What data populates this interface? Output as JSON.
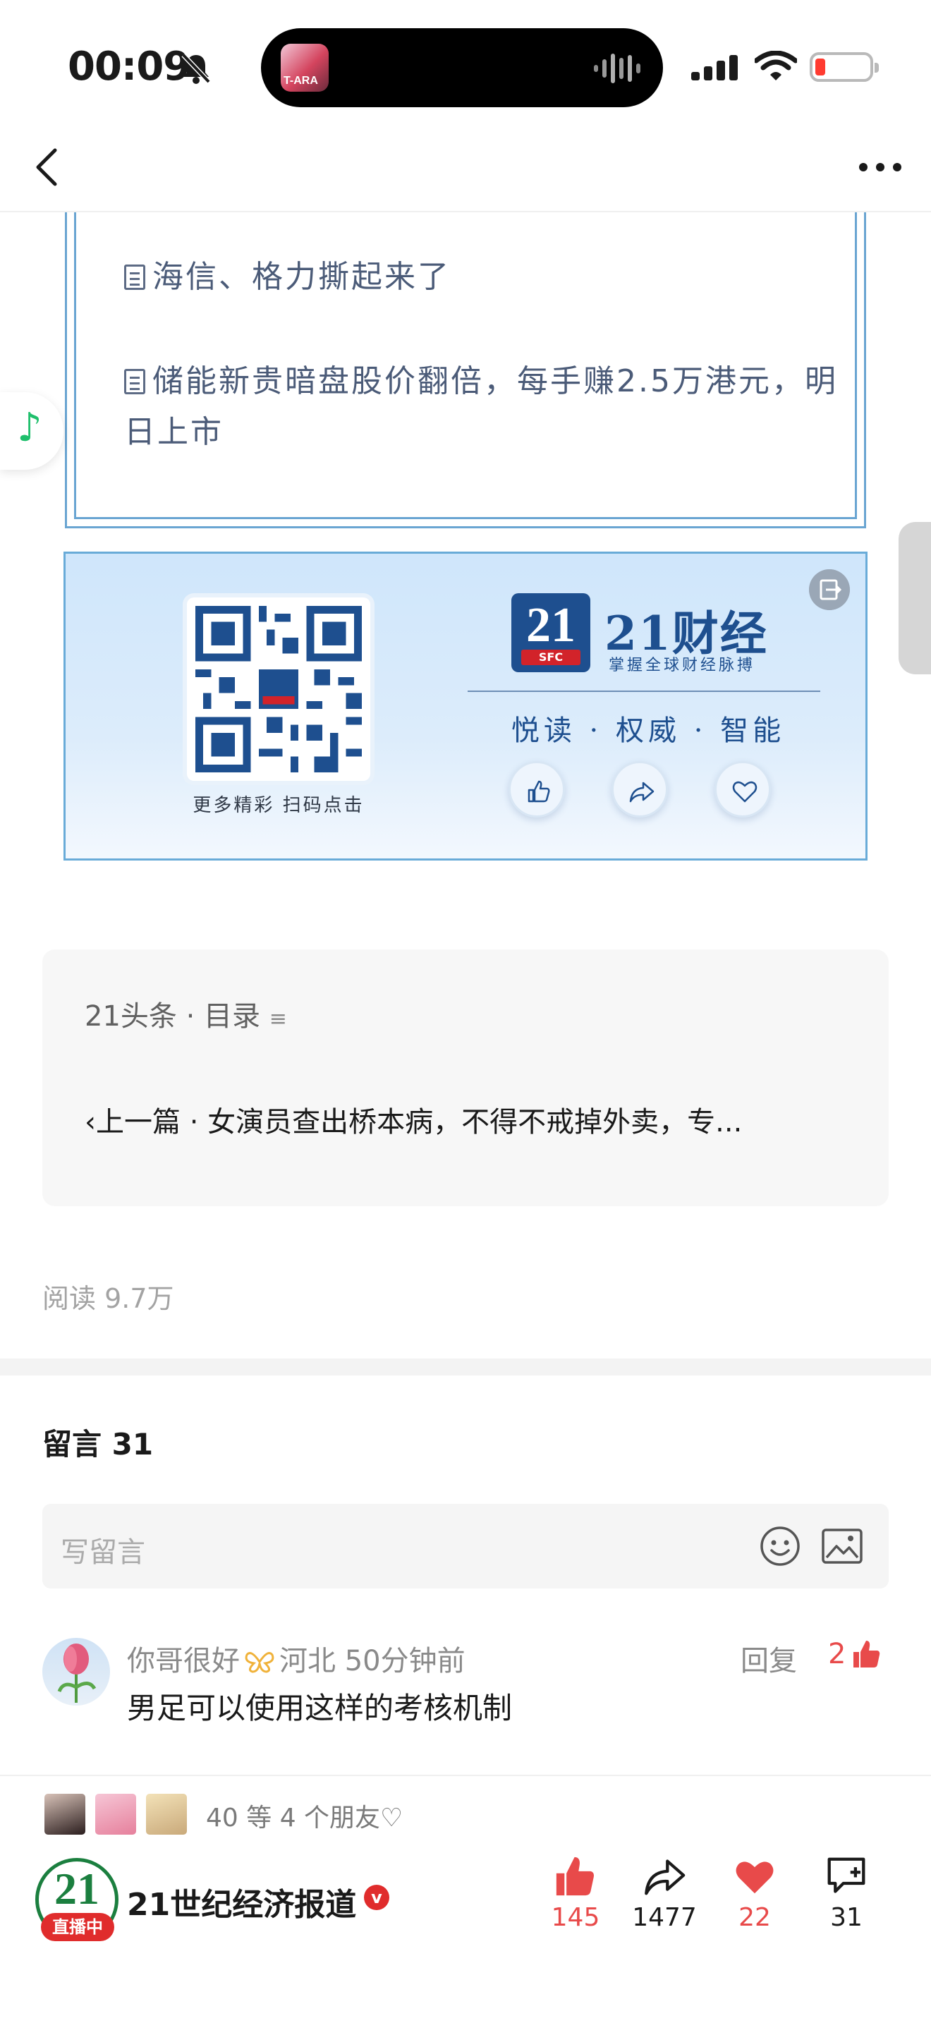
{
  "status_bar": {
    "time": "00:09",
    "island_thumb_text": "T-ARA"
  },
  "related_articles": [
    {
      "title": "海信、格力撕起来了"
    },
    {
      "title": "储能新贵暗盘股价翻倍，每手赚2.5万港元，明日上市"
    }
  ],
  "banner": {
    "qr_caption": "更多精彩 扫码点击",
    "logo_number": "21",
    "logo_sfc": "SFC",
    "brand_name": "21财经",
    "slogan": "掌握全球财经脉搏",
    "motto": "悦读 · 权威 · 智能"
  },
  "toc": {
    "header": "21头条 · 目录",
    "prev_label": "上一篇 · 女演员查出桥本病，不得不戒掉外卖，专..."
  },
  "read_count": "阅读 9.7万",
  "comments_section": {
    "title": "留言 31",
    "input_placeholder": "写留言",
    "items": [
      {
        "author": "你哥很好",
        "location": "河北",
        "time": "50分钟前",
        "text": "男足可以使用这样的考核机制",
        "reply_label": "回复",
        "likes": "2"
      }
    ]
  },
  "footer": {
    "friends_text": "40 等 4 个朋友",
    "account_logo": "21",
    "live_label": "直播中",
    "account_name": "21世纪经济报道",
    "verified_mark": "v",
    "actions": [
      {
        "icon": "thumbs-up-icon",
        "count": "145"
      },
      {
        "icon": "share-icon",
        "count": "1477"
      },
      {
        "icon": "heart-icon",
        "count": "22"
      },
      {
        "icon": "comment-icon",
        "count": "31"
      }
    ]
  },
  "colors": {
    "accent_red": "#e84a4a",
    "brand_blue": "#1e4f8f",
    "box_border": "#6aa5d2"
  }
}
